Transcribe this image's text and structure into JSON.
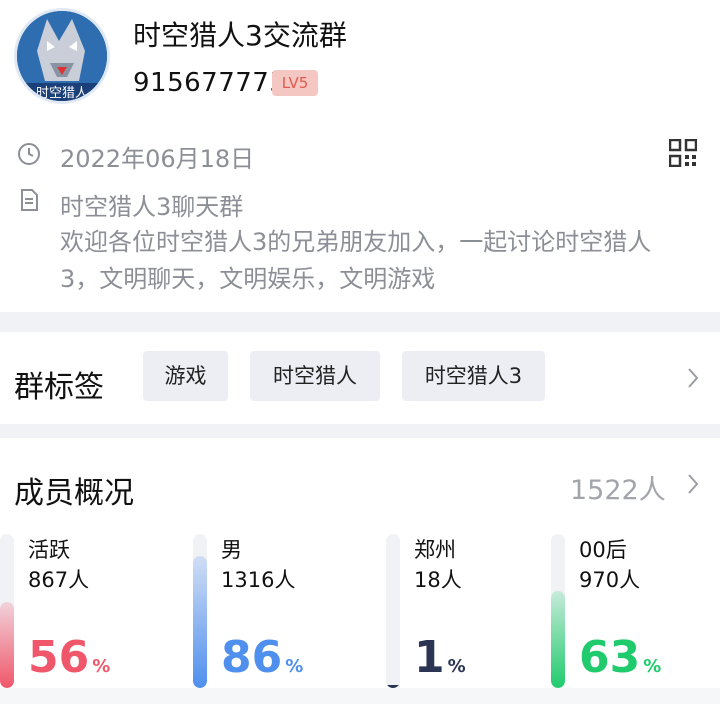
{
  "group": {
    "name": "时空猎人3交流群",
    "id": "915677775",
    "level": "LV5",
    "avatar_text": "时空猎人",
    "created_date": "2022年06月18日",
    "desc_title": "时空猎人3聊天群",
    "desc_body": "欢迎各位时空猎人3的兄弟朋友加入，一起讨论时空猎人3，文明聊天，文明娱乐，文明游戏"
  },
  "tags_section": {
    "title": "群标签",
    "tags": [
      "游戏",
      "时空猎人",
      "时空猎人3"
    ]
  },
  "members": {
    "title": "成员概况",
    "count": "1522人",
    "stats": [
      {
        "label": "活跃",
        "count": "867人",
        "percent": "56",
        "unit": "%",
        "fill": 0.56,
        "color": "#f0576a"
      },
      {
        "label": "男",
        "count": "1316人",
        "percent": "86",
        "unit": "%",
        "fill": 0.86,
        "color": "#4f8fed"
      },
      {
        "label": "郑州",
        "count": "18人",
        "percent": "1",
        "unit": "%",
        "fill": 0.01,
        "color": "#2b3553"
      },
      {
        "label": "00后",
        "count": "970人",
        "percent": "63",
        "unit": "%",
        "fill": 0.63,
        "color": "#1fcb6c"
      }
    ]
  },
  "icons": {
    "clock": "clock-icon",
    "document": "document-icon",
    "qrcode": "qr-code-icon",
    "chevron": "chevron-right-icon"
  }
}
